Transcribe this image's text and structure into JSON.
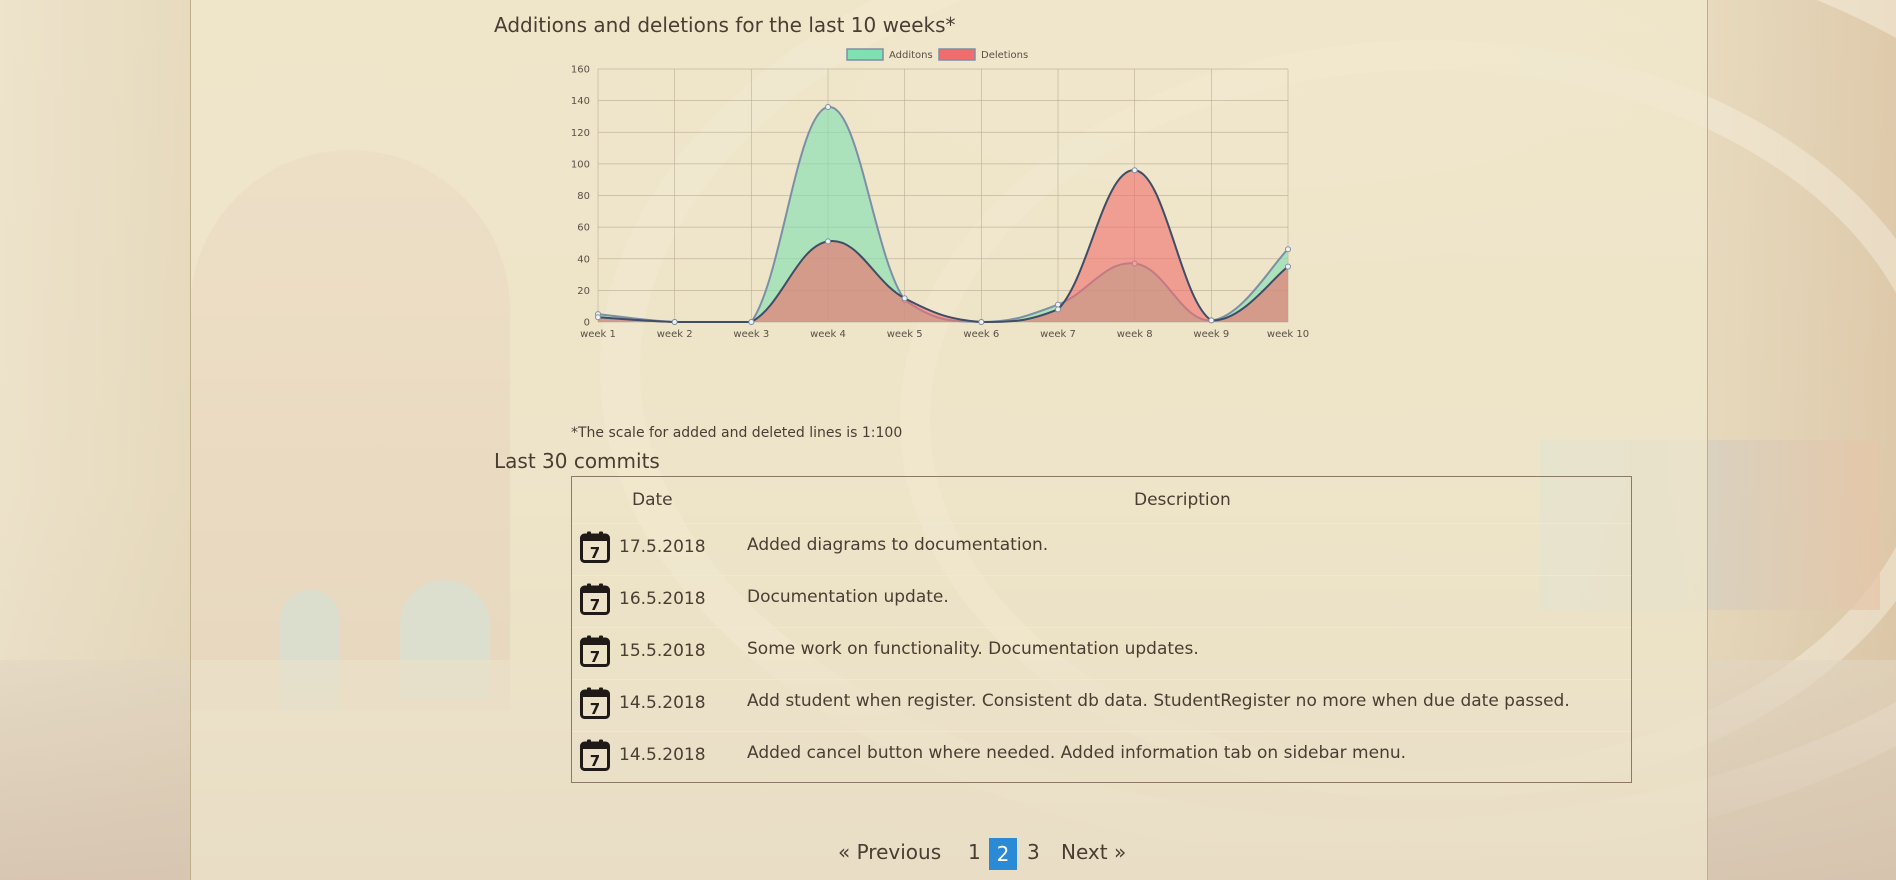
{
  "chart_title": "Additions and deletions for the last 10 weeks*",
  "scale_note": "*The scale for added and deleted lines is 1:100",
  "chart_data": {
    "type": "area",
    "categories": [
      "week 1",
      "week 2",
      "week 3",
      "week 4",
      "week 5",
      "week 6",
      "week 7",
      "week 8",
      "week 9",
      "week 10"
    ],
    "series": [
      {
        "name": "Additons",
        "values": [
          5,
          0,
          0,
          136,
          14,
          0,
          11,
          37,
          1,
          46
        ],
        "color": "#7fe0b0"
      },
      {
        "name": "Deletions",
        "values": [
          3,
          0,
          0,
          51,
          15,
          0,
          8,
          96,
          1,
          35
        ],
        "color": "#f06d6d"
      }
    ],
    "ylim": [
      0,
      160
    ],
    "yticks": [
      0,
      20,
      40,
      60,
      80,
      100,
      120,
      140,
      160
    ],
    "grid": true,
    "legend": "top-center"
  },
  "commits": {
    "title": "Last 30 commits",
    "headers": {
      "date": "Date",
      "description": "Description"
    },
    "rows": [
      {
        "date": "17.5.2018",
        "description": "Added diagrams to documentation."
      },
      {
        "date": "16.5.2018",
        "description": "Documentation update."
      },
      {
        "date": "15.5.2018",
        "description": "Some work on functionality. Documentation updates."
      },
      {
        "date": "14.5.2018",
        "description": "Add student when register. Consistent db data. StudentRegister no more when due date passed."
      },
      {
        "date": "14.5.2018",
        "description": "Added cancel button where needed. Added information tab on sidebar menu."
      }
    ],
    "icon": "calendar-icon"
  },
  "pagination": {
    "prev": "« Previous",
    "pages": [
      "1",
      "2",
      "3"
    ],
    "active_page": "2",
    "next": "Next »",
    "active_color": "#2a8ad6"
  }
}
